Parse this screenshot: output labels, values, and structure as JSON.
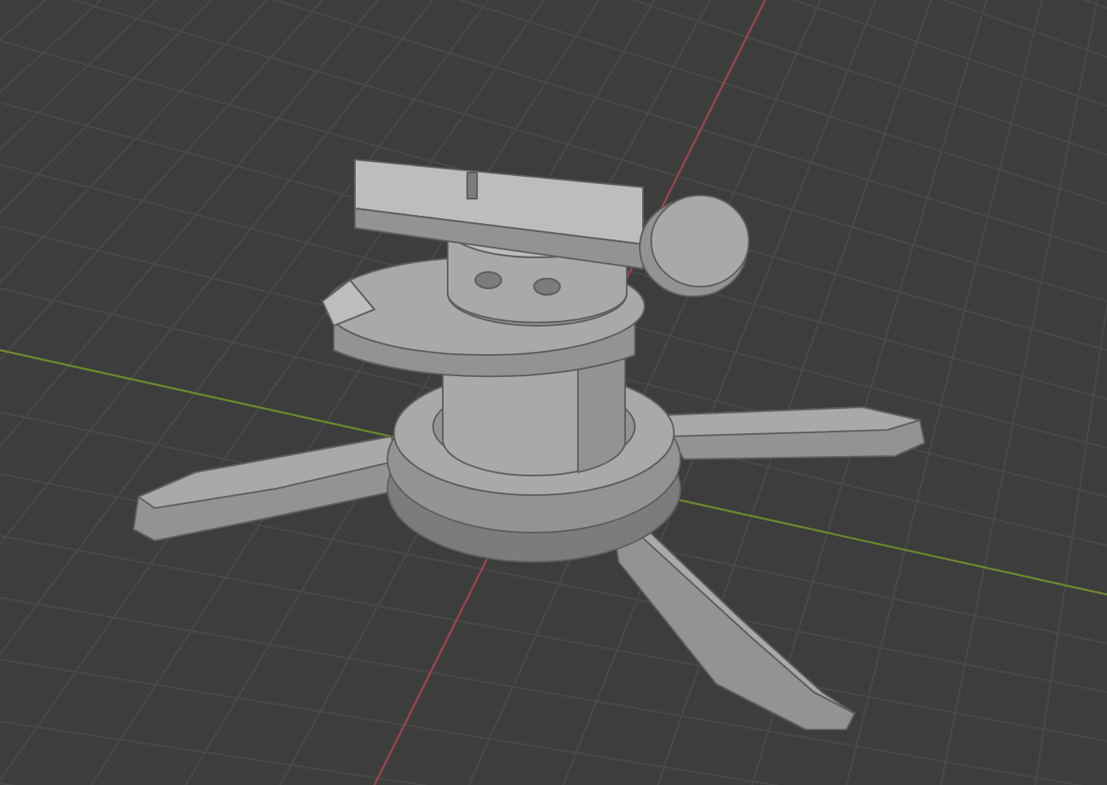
{
  "viewport": {
    "axes": [
      {
        "kind": "x",
        "color": "#a3434d"
      },
      {
        "kind": "y",
        "color": "#6a8a2c"
      }
    ]
  }
}
